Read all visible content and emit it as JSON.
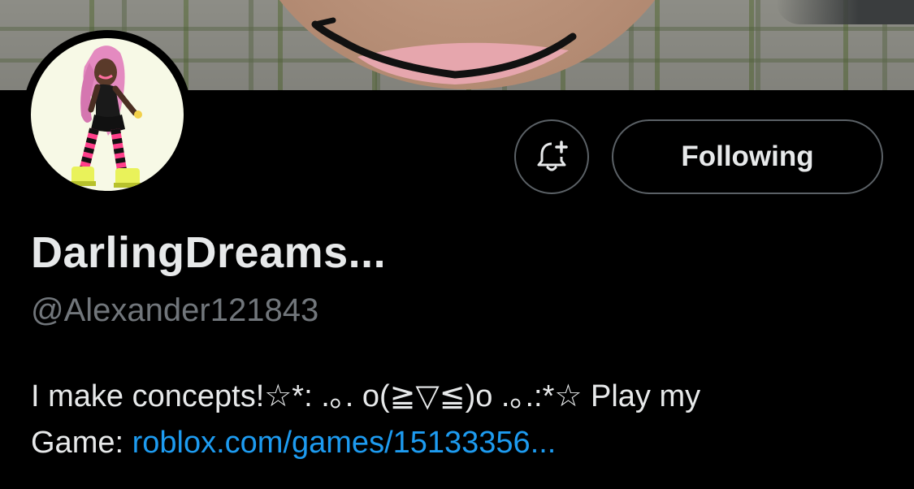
{
  "profile": {
    "display_name": "DarlingDreams...",
    "handle": "@Alexander121843",
    "bio_text_line1": "I make concepts!☆*: .｡. o(≧▽≦)o .｡.:*☆ Play my",
    "bio_text_prefix": "Game: ",
    "bio_link": "roblox.com/games/15133356..."
  },
  "actions": {
    "following_label": "Following",
    "notify_icon": "bell-plus-icon"
  },
  "colors": {
    "background": "#000000",
    "text_primary": "#e7e9ea",
    "text_secondary": "#71767b",
    "link": "#1d9bf0",
    "button_border": "#5b6166"
  }
}
